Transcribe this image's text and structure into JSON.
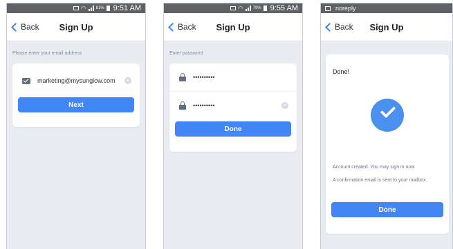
{
  "screens": [
    {
      "status_bar": {
        "battery": "81%",
        "time": "9:51 AM"
      },
      "nav": {
        "back": "Back",
        "title": "Sign Up"
      },
      "hint": "Please enter your email address",
      "email_value": "marketing@mysunglow.com",
      "clear_icon": "clear-icon",
      "button": "Next"
    },
    {
      "status_bar": {
        "battery": "79%",
        "time": "9:55 AM"
      },
      "nav": {
        "back": "Back",
        "title": "Sign Up"
      },
      "hint": "Enter password",
      "password_value": "••••••••••",
      "confirm_password_value": "••••••••••",
      "button": "Done"
    },
    {
      "status_bar": {
        "notification": "noreply"
      },
      "nav": {
        "back": "Back",
        "title": "Sign Up"
      },
      "done_title": "Done!",
      "message_1": "Account created. You may sign in now.",
      "message_2": "A confirmation email is sent to your mailbox.",
      "button": "Done"
    }
  ],
  "colors": {
    "accent": "#4285f4",
    "check": "#4a90ee",
    "background": "#e9edf2"
  }
}
